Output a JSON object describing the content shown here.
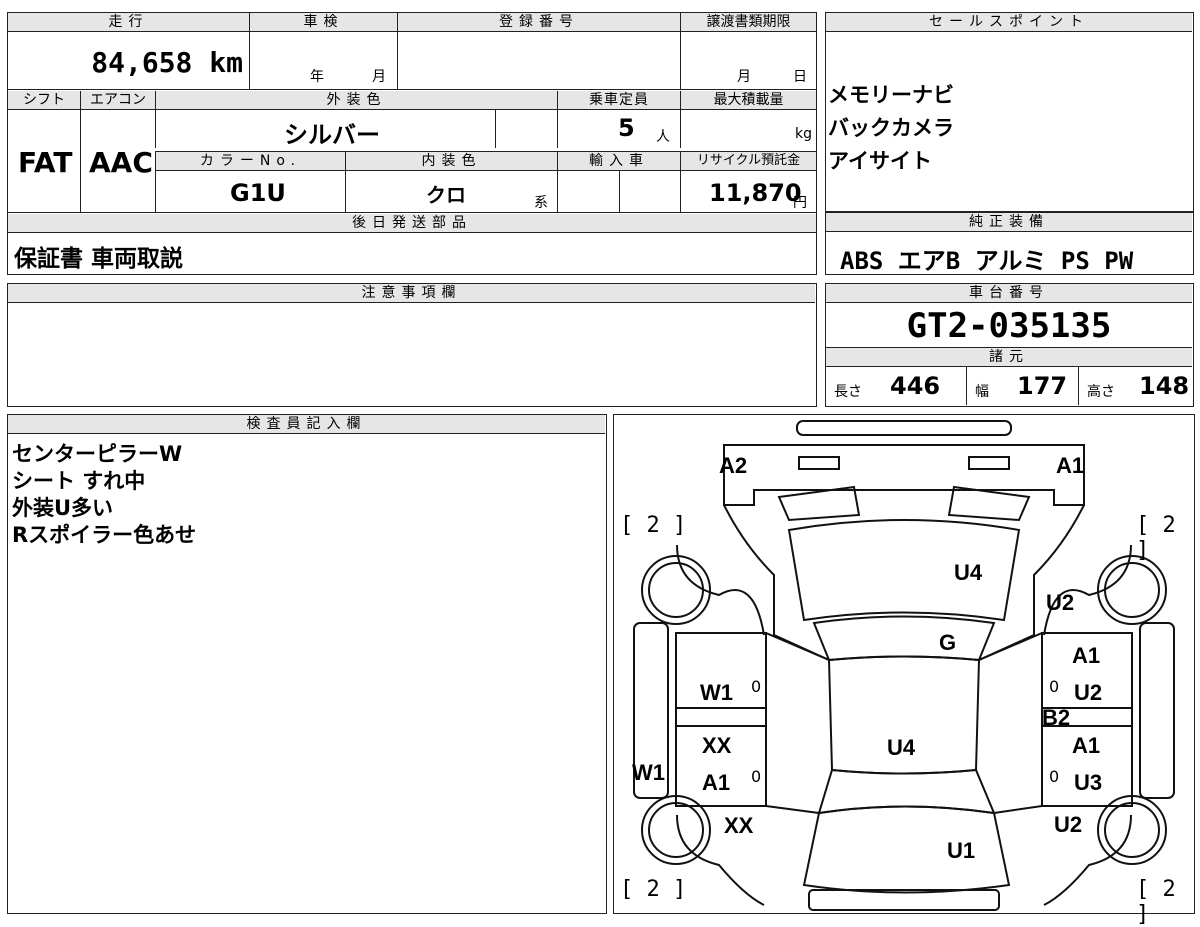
{
  "mileage": {
    "label": "走行",
    "value": "84,658",
    "unit": "km"
  },
  "inspection": {
    "label": "車検",
    "year_unit": "年",
    "month_unit": "月"
  },
  "registration": {
    "label": "登録番号"
  },
  "transfer_deadline": {
    "label": "譲渡書類期限",
    "month_unit": "月",
    "day_unit": "日"
  },
  "shift": {
    "label": "シフト",
    "value": "FAT"
  },
  "aircon": {
    "label": "エアコン",
    "value": "AAC"
  },
  "exterior_color": {
    "label": "外装色",
    "value": "シルバー"
  },
  "capacity": {
    "label": "乗車定員",
    "value": "5",
    "unit": "人"
  },
  "max_load": {
    "label": "最大積載量",
    "unit": "kg"
  },
  "color_no": {
    "label": "カラーNo.",
    "value": "G1U"
  },
  "interior_color": {
    "label": "内装色",
    "value": "クロ",
    "suffix": "系"
  },
  "import_car": {
    "label": "輸入車"
  },
  "recycle_fee": {
    "label": "リサイクル預託金",
    "value": "11,870",
    "unit": "円"
  },
  "later_parts": {
    "label": "後日発送部品",
    "value": "保証書 車両取説"
  },
  "sales_points": {
    "label": "セールスポイント",
    "items": [
      "メモリーナビ",
      "バックカメラ",
      "アイサイト"
    ]
  },
  "equipment": {
    "label": "純正装備",
    "value": "ABS エアB アルミ PS PW"
  },
  "notes": {
    "label": "注意事項欄"
  },
  "chassis": {
    "label": "車台番号",
    "value": "GT2-035135"
  },
  "specs": {
    "label": "諸元",
    "length": {
      "label": "長さ",
      "value": "446"
    },
    "width": {
      "label": "幅",
      "value": "177"
    },
    "height": {
      "label": "高さ",
      "value": "148"
    }
  },
  "inspector": {
    "label": "検査員記入欄",
    "lines": [
      "センターピラーW",
      "シート すれ中",
      "外装U多い",
      "Rスポイラー色あせ"
    ]
  },
  "diagram": {
    "tire_mark": "[ 2 ]",
    "labels": {
      "a2": "A2",
      "a1_top": "A1",
      "u4_hood": "U4",
      "u2_front_r": "U2",
      "g": "G",
      "a1_r1": "A1",
      "u2_r": "U2",
      "b2": "B2",
      "a1_r2": "A1",
      "u3_r": "U3",
      "u2_rear_r": "U2",
      "w1_l": "W1",
      "xx_l1": "XX",
      "w1_side": "W1",
      "a1_l": "A1",
      "xx_l2": "XX",
      "u4_roof": "U4",
      "u1": "U1",
      "zero": "0"
    }
  }
}
